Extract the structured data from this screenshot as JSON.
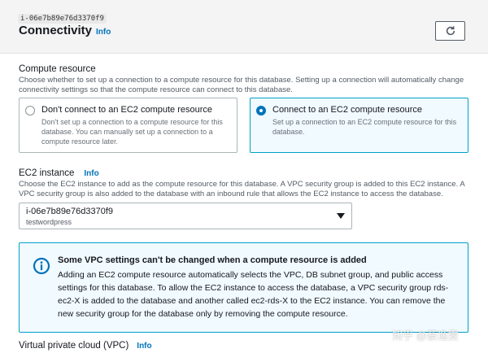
{
  "header": {
    "instance_tooltip": "i-06e7b89e76d3370f9",
    "title": "Connectivity",
    "info": "Info"
  },
  "compute_resource": {
    "label": "Compute resource",
    "description": "Choose whether to set up a connection to a compute resource for this database. Setting up a connection will automatically change connectivity settings so that the compute resource can connect to this database.",
    "options": [
      {
        "title": "Don't connect to an EC2 compute resource",
        "description": "Don't set up a connection to a compute resource for this database. You can manually set up a connection to a compute resource later.",
        "selected": false
      },
      {
        "title": "Connect to an EC2 compute resource",
        "description": "Set up a connection to an EC2 compute resource for this database.",
        "selected": true
      }
    ]
  },
  "ec2_instance": {
    "label": "EC2 instance",
    "info": "Info",
    "description": "Choose the EC2 instance to add as the compute resource for this database. A VPC security group is added to this EC2 instance. A VPC security group is also added to the database with an inbound rule that allows the EC2 instance to access the database.",
    "selected_value": "i-06e7b89e76d3370f9",
    "selected_sub": "testwordpress"
  },
  "alert": {
    "title": "Some VPC settings can't be changed when a compute resource is added",
    "body": "Adding an EC2 compute resource automatically selects the VPC, DB subnet group, and public access settings for this database. To allow the EC2 instance to access the database, a VPC security group rds-ec2-X is added to the database and another called ec2-rds-X to the EC2 instance. You can remove the new security group for the database only by removing the compute resource."
  },
  "vpc": {
    "label": "Virtual private cloud (VPC)",
    "info": "Info"
  },
  "watermark": "知乎 @蔡逸雯",
  "colors": {
    "accent": "#0073bb",
    "info_border": "#00a1c9",
    "info_bg": "#f1faff"
  },
  "icons": [
    "refresh-icon",
    "info-circle-icon",
    "caret-down-icon"
  ]
}
